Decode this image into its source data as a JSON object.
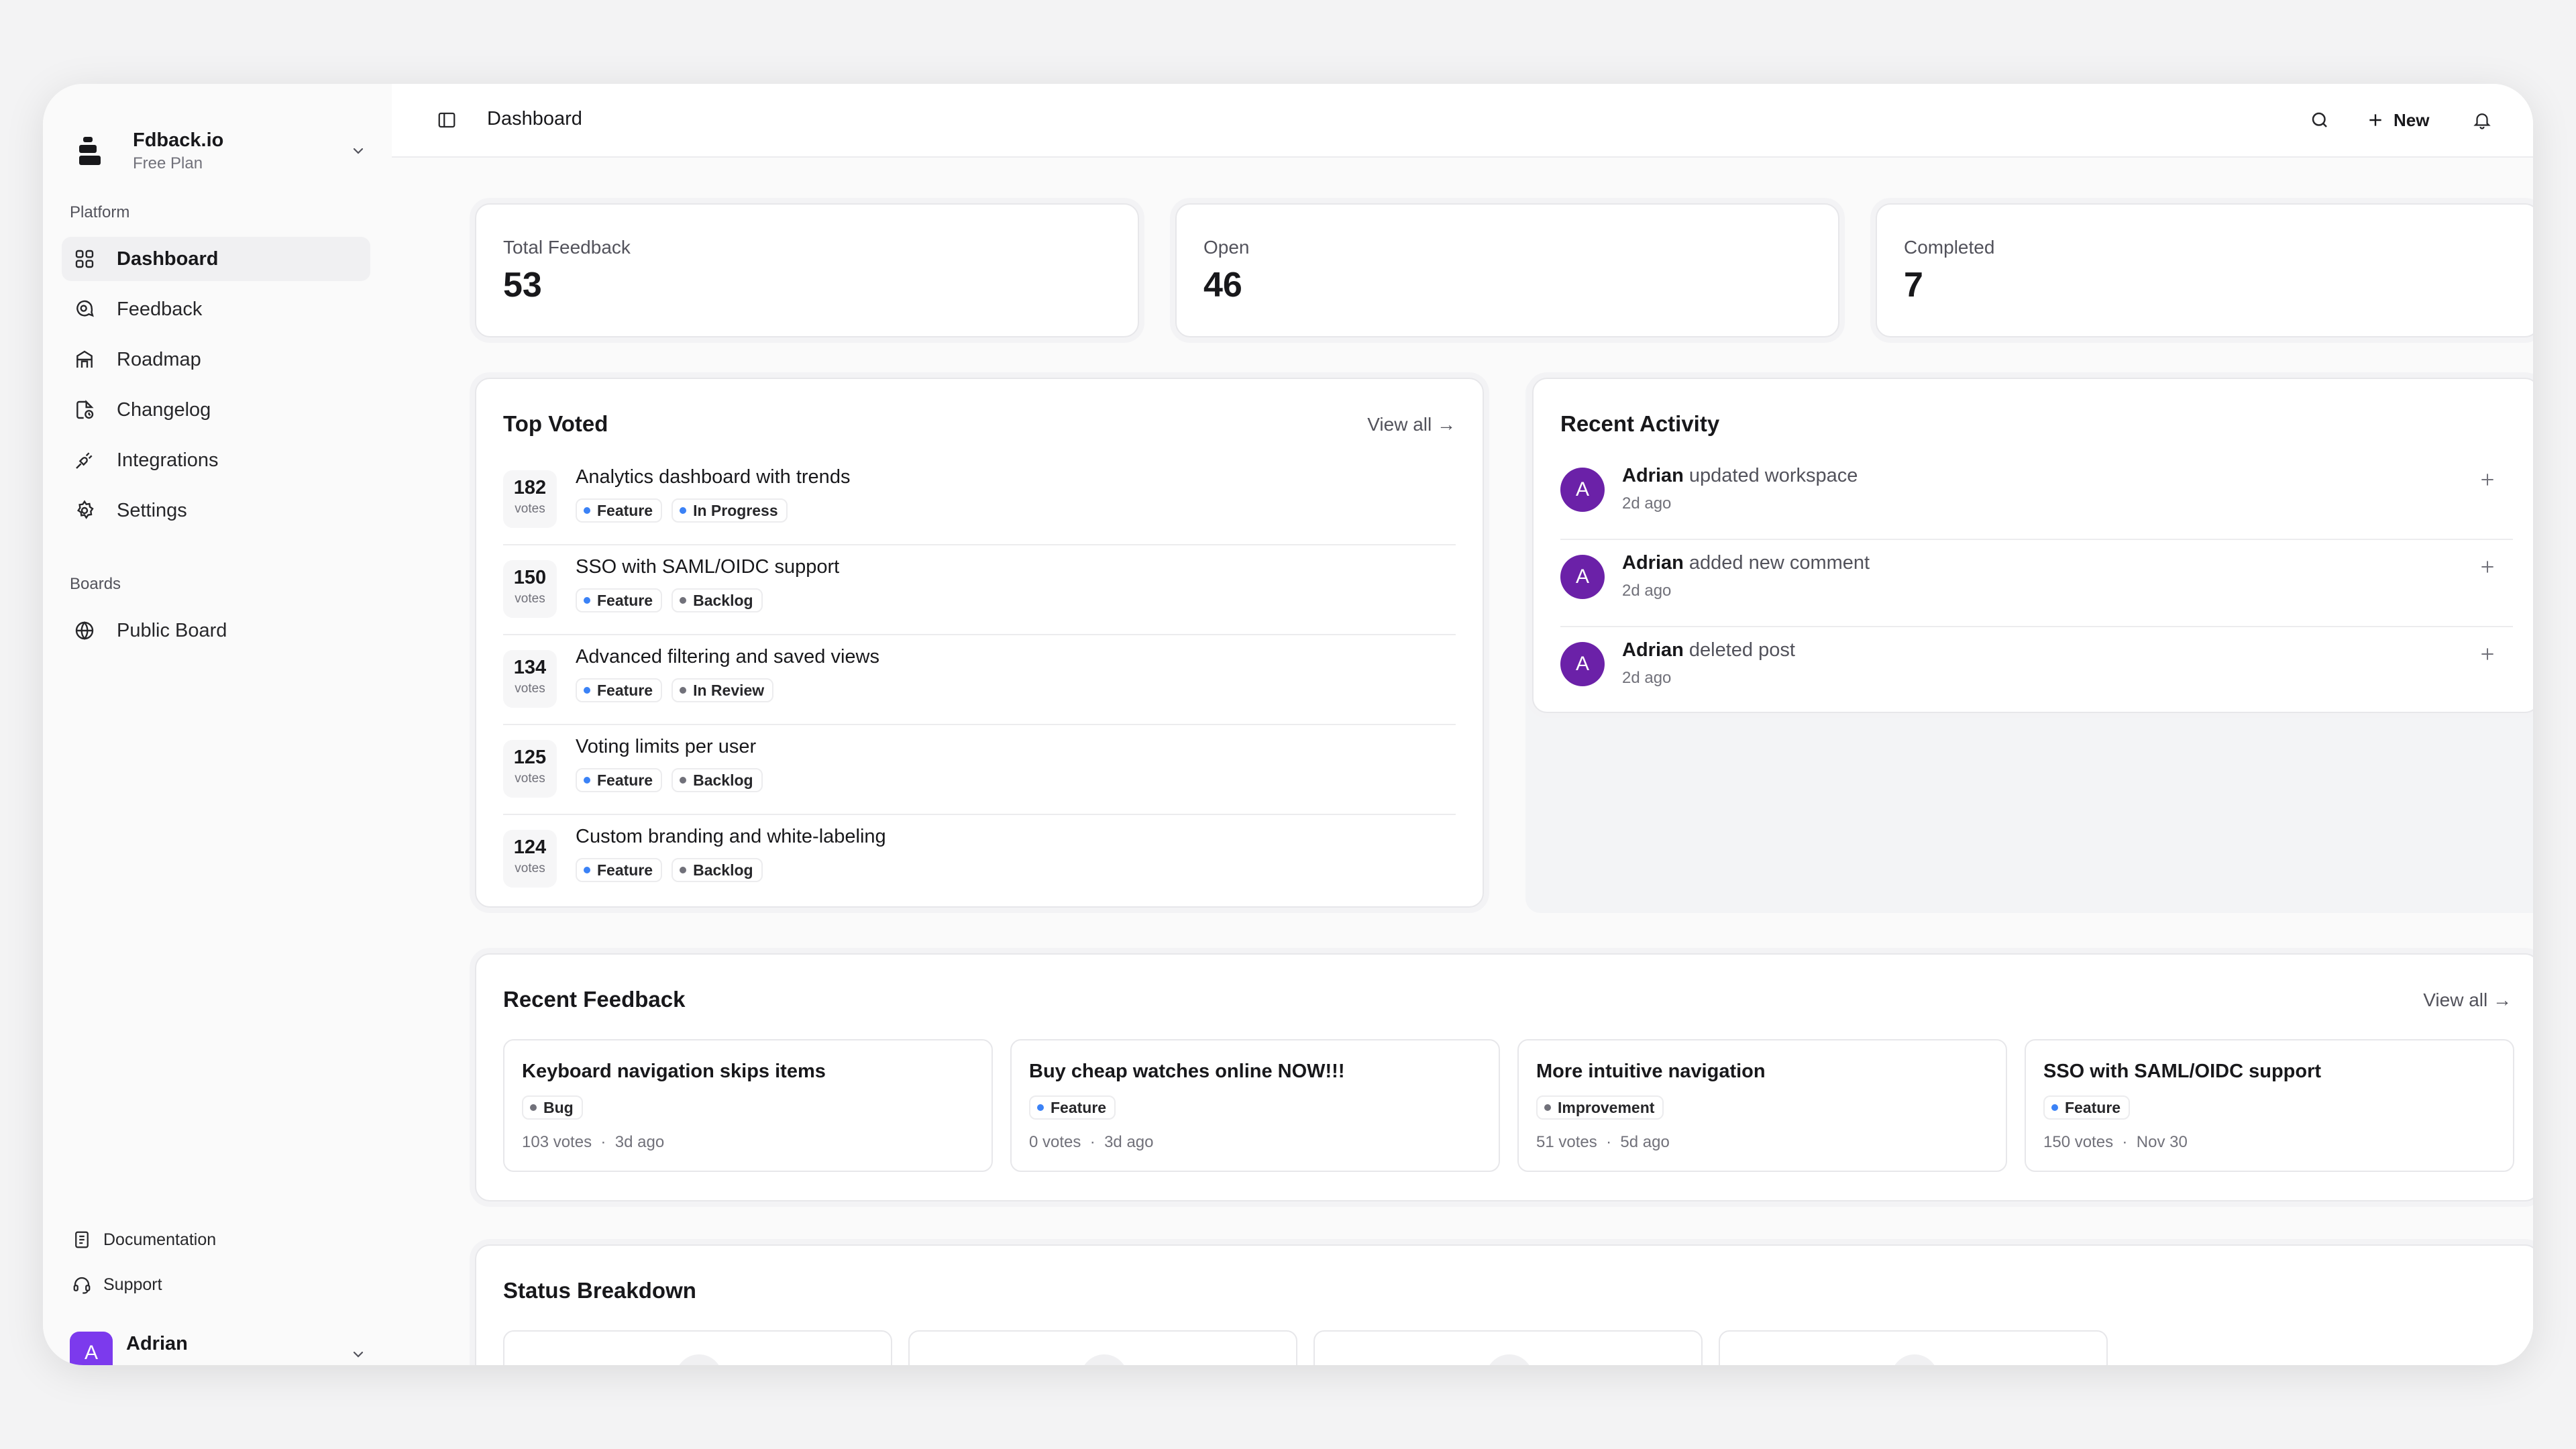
{
  "brand": {
    "name": "Fdback.io",
    "plan": "Free Plan"
  },
  "sidebar": {
    "platform_label": "Platform",
    "items": [
      {
        "label": "Dashboard",
        "icon": "dashboard-grid-icon"
      },
      {
        "label": "Feedback",
        "icon": "message-search-icon"
      },
      {
        "label": "Roadmap",
        "icon": "roadmap-icon"
      },
      {
        "label": "Changelog",
        "icon": "changelog-icon"
      },
      {
        "label": "Integrations",
        "icon": "plug-icon"
      },
      {
        "label": "Settings",
        "icon": "gear-icon"
      }
    ],
    "boards_label": "Boards",
    "boards": [
      {
        "label": "Public Board",
        "icon": "globe-icon"
      }
    ],
    "footer": [
      {
        "label": "Documentation",
        "icon": "book-icon"
      },
      {
        "label": "Support",
        "icon": "headset-icon"
      }
    ],
    "user": {
      "name": "Adrian",
      "initial": "A"
    }
  },
  "topbar": {
    "breadcrumb": "Dashboard",
    "new_label": "New"
  },
  "stats": [
    {
      "label": "Total Feedback",
      "value": "53"
    },
    {
      "label": "Open",
      "value": "46"
    },
    {
      "label": "Completed",
      "value": "7"
    }
  ],
  "top_voted": {
    "title": "Top Voted",
    "view_all": "View all →",
    "votes_label": "votes",
    "items": [
      {
        "votes": "182",
        "title": "Analytics dashboard with trends",
        "tags": [
          {
            "label": "Feature",
            "color": "#3b82f6"
          },
          {
            "label": "In Progress",
            "color": "#3b82f6"
          }
        ]
      },
      {
        "votes": "150",
        "title": "SSO with SAML/OIDC support",
        "tags": [
          {
            "label": "Feature",
            "color": "#3b82f6"
          },
          {
            "label": "Backlog",
            "color": "#71717a"
          }
        ]
      },
      {
        "votes": "134",
        "title": "Advanced filtering and saved views",
        "tags": [
          {
            "label": "Feature",
            "color": "#3b82f6"
          },
          {
            "label": "In Review",
            "color": "#71717a"
          }
        ]
      },
      {
        "votes": "125",
        "title": "Voting limits per user",
        "tags": [
          {
            "label": "Feature",
            "color": "#3b82f6"
          },
          {
            "label": "Backlog",
            "color": "#71717a"
          }
        ]
      },
      {
        "votes": "124",
        "title": "Custom branding and white-labeling",
        "tags": [
          {
            "label": "Feature",
            "color": "#3b82f6"
          },
          {
            "label": "Backlog",
            "color": "#71717a"
          }
        ]
      }
    ]
  },
  "recent_activity": {
    "title": "Recent Activity",
    "items": [
      {
        "initial": "A",
        "user": "Adrian",
        "action": "updated workspace",
        "time": "2d ago"
      },
      {
        "initial": "A",
        "user": "Adrian",
        "action": "added new comment",
        "time": "2d ago"
      },
      {
        "initial": "A",
        "user": "Adrian",
        "action": "deleted post",
        "time": "2d ago"
      }
    ]
  },
  "recent_feedback": {
    "title": "Recent Feedback",
    "view_all": "View all →",
    "items": [
      {
        "title": "Keyboard navigation skips items",
        "tag": "Bug",
        "tag_color": "#71717a",
        "votes": "103 votes",
        "sep": "·",
        "date": "3d ago"
      },
      {
        "title": "Buy cheap watches online NOW!!!",
        "tag": "Feature",
        "tag_color": "#3b82f6",
        "votes": "0 votes",
        "sep": "·",
        "date": "3d ago"
      },
      {
        "title": "More intuitive navigation",
        "tag": "Improvement",
        "tag_color": "#71717a",
        "votes": "51 votes",
        "sep": "·",
        "date": "5d ago"
      },
      {
        "title": "SSO with SAML/OIDC support",
        "tag": "Feature",
        "tag_color": "#3b82f6",
        "votes": "150 votes",
        "sep": "·",
        "date": "Nov 30"
      }
    ]
  },
  "status_breakdown": {
    "title": "Status Breakdown"
  }
}
